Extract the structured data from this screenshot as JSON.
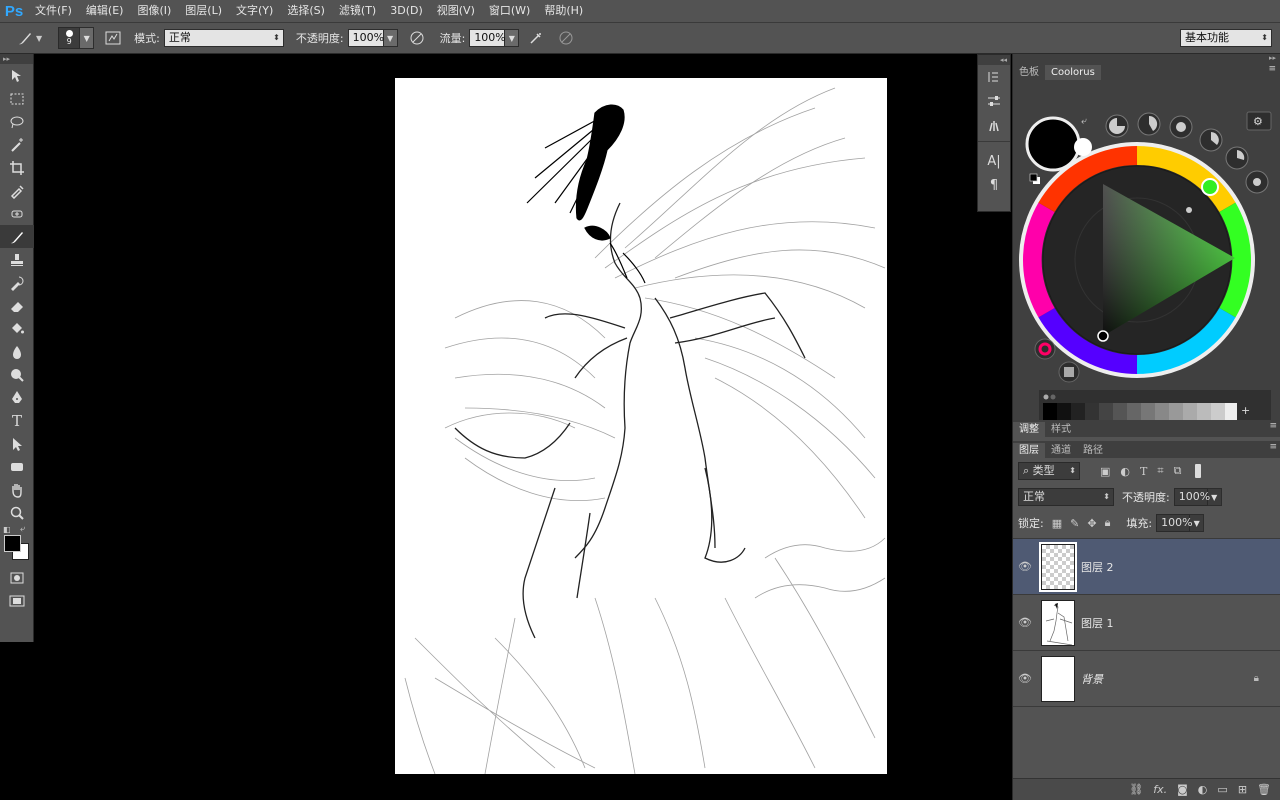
{
  "app": {
    "logo": "Ps"
  },
  "menu": [
    "文件(F)",
    "编辑(E)",
    "图像(I)",
    "图层(L)",
    "文字(Y)",
    "选择(S)",
    "滤镜(T)",
    "3D(D)",
    "视图(V)",
    "窗口(W)",
    "帮助(H)"
  ],
  "options": {
    "brush_size": "9",
    "mode_label": "模式:",
    "mode_value": "正常",
    "opacity_label": "不透明度:",
    "opacity_value": "100%",
    "flow_label": "流量:",
    "flow_value": "100%",
    "workspace": "基本功能"
  },
  "color_panel": {
    "tabs": [
      "色板",
      "Coolorus"
    ],
    "active_tab": "Coolorus",
    "foreground": "#000000",
    "background": "#ffffff",
    "hue_color": "#44ff22"
  },
  "adjust_tabs": [
    "调整",
    "样式"
  ],
  "layers_panel": {
    "tabs": [
      "图层",
      "通道",
      "路径"
    ],
    "filter_label": "类型",
    "blend_mode": "正常",
    "opacity_label": "不透明度:",
    "opacity_value": "100%",
    "lock_label": "锁定:",
    "fill_label": "填充:",
    "fill_value": "100%",
    "layers": [
      {
        "name": "图层 2",
        "selected": true
      },
      {
        "name": "图层 1",
        "selected": false
      },
      {
        "name": "背景",
        "selected": false,
        "locked": true
      }
    ]
  }
}
